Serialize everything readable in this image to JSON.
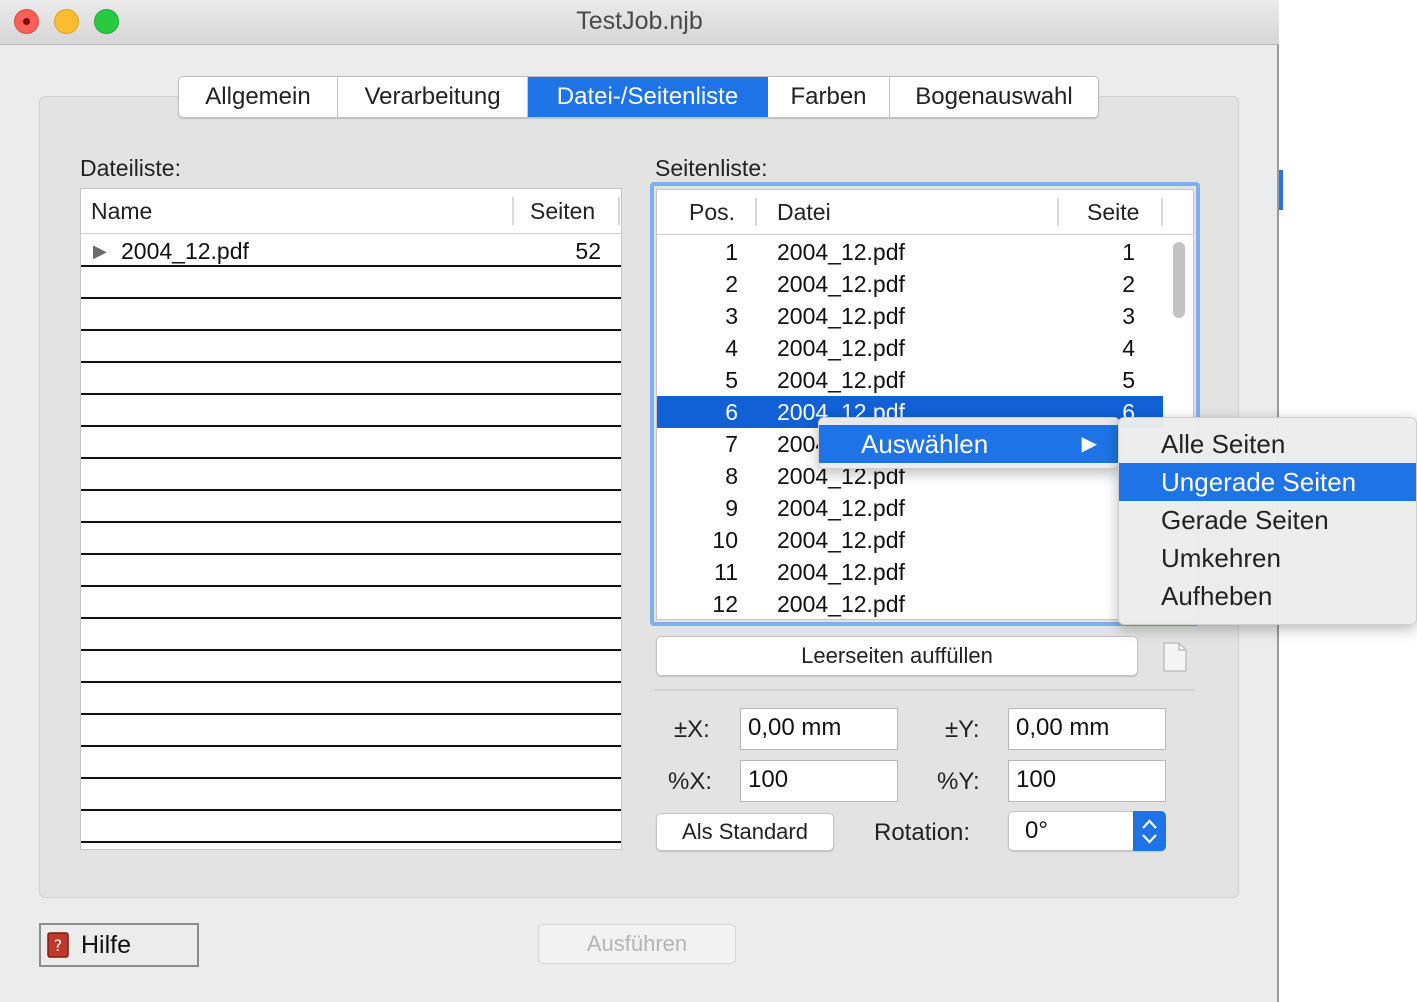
{
  "window": {
    "title": "TestJob.njb"
  },
  "tabs": [
    {
      "label": "Allgemein",
      "active": false
    },
    {
      "label": "Verarbeitung",
      "active": false
    },
    {
      "label": "Datei-/Seitenliste",
      "active": true
    },
    {
      "label": "Farben",
      "active": false
    },
    {
      "label": "Bogenauswahl",
      "active": false
    }
  ],
  "file_list": {
    "label": "Dateiliste:",
    "columns": {
      "name": "Name",
      "pages": "Seiten"
    },
    "rows": [
      {
        "name": "2004_12.pdf",
        "pages": "52"
      }
    ]
  },
  "page_list": {
    "label": "Seitenliste:",
    "columns": {
      "pos": "Pos.",
      "file": "Datei",
      "page": "Seite"
    },
    "rows": [
      {
        "pos": "1",
        "file": "2004_12.pdf",
        "page": "1"
      },
      {
        "pos": "2",
        "file": "2004_12.pdf",
        "page": "2"
      },
      {
        "pos": "3",
        "file": "2004_12.pdf",
        "page": "3"
      },
      {
        "pos": "4",
        "file": "2004_12.pdf",
        "page": "4"
      },
      {
        "pos": "5",
        "file": "2004_12.pdf",
        "page": "5"
      },
      {
        "pos": "6",
        "file": "2004_12.pdf",
        "page": "6"
      },
      {
        "pos": "7",
        "file": "2004_12.pdf",
        "page": ""
      },
      {
        "pos": "8",
        "file": "2004_12.pdf",
        "page": ""
      },
      {
        "pos": "9",
        "file": "2004_12.pdf",
        "page": ""
      },
      {
        "pos": "10",
        "file": "2004_12.pdf",
        "page": ""
      },
      {
        "pos": "11",
        "file": "2004_12.pdf",
        "page": ""
      },
      {
        "pos": "12",
        "file": "2004_12.pdf",
        "page": ""
      }
    ],
    "selected_pos": "6"
  },
  "context_menu": {
    "item": "Auswählen",
    "submenu": [
      "Alle Seiten",
      "Ungerade Seiten",
      "Gerade Seiten",
      "Umkehren",
      "Aufheben"
    ],
    "highlighted": "Ungerade Seiten"
  },
  "buttons": {
    "fill_blank": "Leerseiten auffüllen",
    "as_default": "Als Standard",
    "help": "Hilfe",
    "execute": "Ausführen"
  },
  "offsets": {
    "x_label": "±X:",
    "x_value": "0,00 mm",
    "y_label": "±Y:",
    "y_value": "0,00 mm",
    "px_label": "%X:",
    "px_value": "100",
    "py_label": "%Y:",
    "py_value": "100",
    "rotation_label": "Rotation:",
    "rotation_value": "0°"
  },
  "colors": {
    "accent": "#1e73e6",
    "selection": "#1160d6"
  }
}
